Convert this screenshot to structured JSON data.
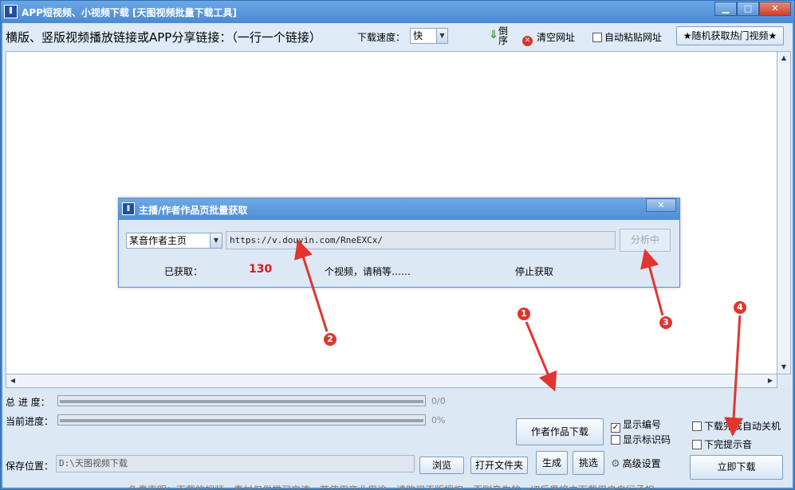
{
  "window": {
    "title": "APP短视频、小视频下载 [天图视频批量下载工具]",
    "icon": "app-logo-icon",
    "controls": [
      "▁",
      "□",
      "✕"
    ]
  },
  "toolbar": {
    "instruction": "横版、竖版视频播放链接或APP分享链接：（一行一个链接）",
    "speed_label": "下载速度：",
    "speed_value": "快",
    "reverse_label": "倒序",
    "clear_label": "清空网址",
    "auto_paste_label": "自动粘贴网址",
    "hot_video_label": "★随机获取热门视频★"
  },
  "dialog": {
    "title": "主播/作者作品页批量获取",
    "source_value": "某音作者主页",
    "url_value": "https://v.douyin.com/RneEXCx/",
    "analyze_label": "分析中",
    "fetched_label": "已获取：",
    "fetched_count": "130",
    "wait_text": "个视频，请稍等……",
    "stop_label": "停止获取"
  },
  "progress": {
    "total_label": "总 进 度：",
    "total_text": "0/0",
    "total_fraction": 0,
    "current_label": "当前进度：",
    "current_text": "0%",
    "current_fraction": 0
  },
  "save": {
    "label": "保存位置：",
    "path": "D:\\天图视频下载",
    "browse_label": "浏览",
    "open_folder_label": "打开文件夹"
  },
  "actions": {
    "author_download_label": "作者作品下载",
    "generate_label": "生成",
    "pick_label": "挑选",
    "advanced_label": "高级设置",
    "download_now_label": "立即下载"
  },
  "options": {
    "show_number_label": "显示编号",
    "show_number_checked": true,
    "show_watermark_label": "显示标识码",
    "show_watermark_checked": false,
    "shutdown_label": "下载完成自动关机",
    "shutdown_checked": false,
    "sound_label": "下完提示音",
    "sound_checked": false
  },
  "disclaimer": "免责声明：下载的视频、素材仅供学习交流，若使用商业用途，请购买正版授权，否则产生的一切后果将由下载用户自行承担。",
  "annotations": [
    {
      "num": "1"
    },
    {
      "num": "2"
    },
    {
      "num": "3"
    },
    {
      "num": "4"
    }
  ],
  "colors": {
    "accent_red": "#e1352f",
    "count_red": "#d31d1d",
    "title_blue": "#4f8ed5"
  }
}
